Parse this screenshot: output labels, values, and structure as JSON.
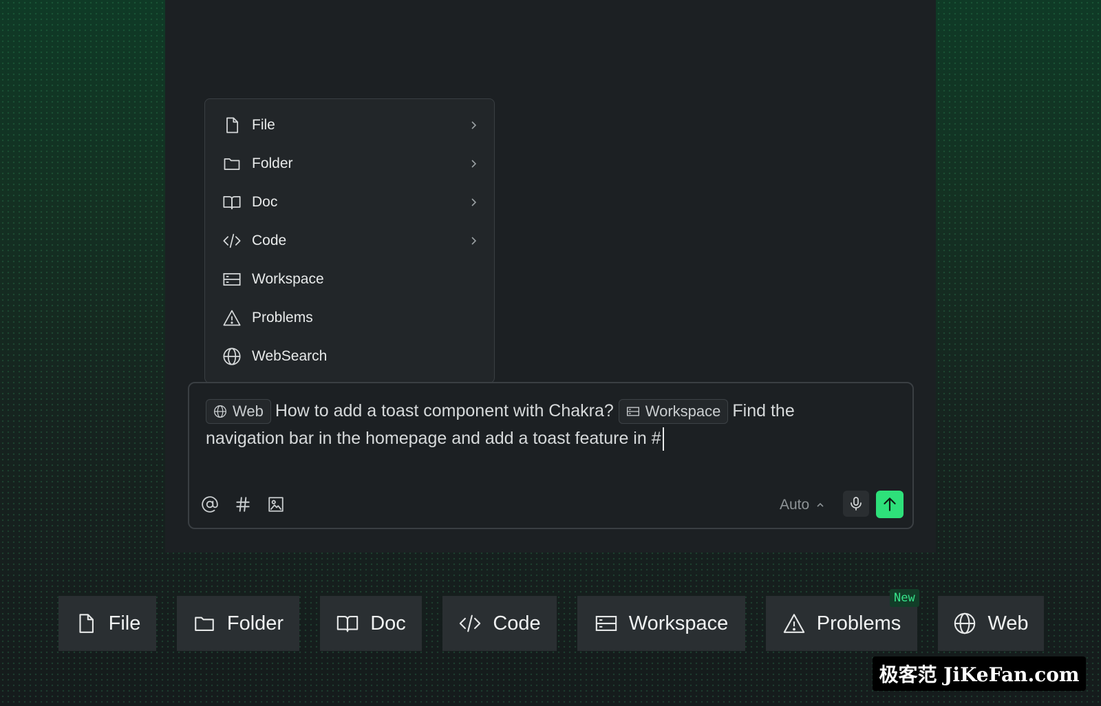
{
  "menu": {
    "items": [
      {
        "label": "File",
        "icon": "file-icon",
        "submenu": true
      },
      {
        "label": "Folder",
        "icon": "folder-icon",
        "submenu": true
      },
      {
        "label": "Doc",
        "icon": "book-icon",
        "submenu": true
      },
      {
        "label": "Code",
        "icon": "code-icon",
        "submenu": true
      },
      {
        "label": "Workspace",
        "icon": "workspace-icon",
        "submenu": false
      },
      {
        "label": "Problems",
        "icon": "warning-icon",
        "submenu": false
      },
      {
        "label": "WebSearch",
        "icon": "globe-icon",
        "submenu": false
      }
    ]
  },
  "composer": {
    "chip_web": "Web",
    "text_1": "How to add a toast component with Chakra?",
    "chip_workspace": "Workspace",
    "text_2": "Find the navigation bar in the homepage and add a toast feature in #",
    "model_select": "Auto"
  },
  "bottom_bar": {
    "file": "File",
    "folder": "Folder",
    "doc": "Doc",
    "code": "Code",
    "workspace": "Workspace",
    "problems": "Problems",
    "web": "Web",
    "new_badge": "New"
  },
  "watermark": "极客范 JiKeFan.com",
  "colors": {
    "accent": "#2ee07a",
    "panel": "#1c2023",
    "menu_bg": "#222629"
  }
}
